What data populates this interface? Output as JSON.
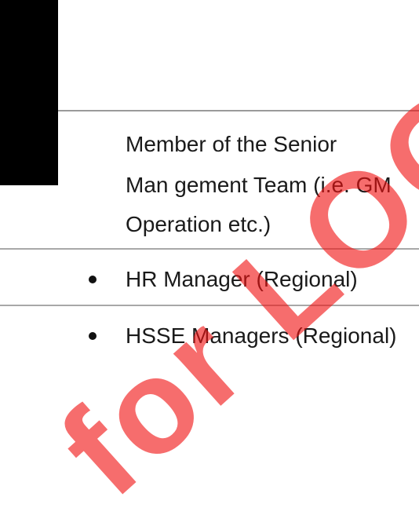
{
  "watermark": {
    "text": "for LOGIMAX",
    "color": "#f01414"
  },
  "document": {
    "paragraph_lines": [
      "Member of the Senior",
      "Man  gement Team (i.e. GM",
      "Operation etc.)"
    ],
    "bullets": [
      "HR Manager (Regional)",
      "HSSE Managers (Regional)"
    ]
  }
}
